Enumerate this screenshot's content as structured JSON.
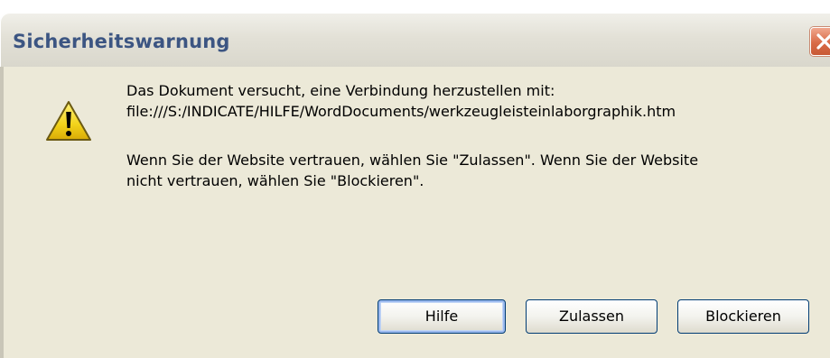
{
  "window": {
    "title": "Sicherheitswarnung",
    "close_icon": "close-icon"
  },
  "dialog": {
    "icon": "warning-icon",
    "message_line1": "Das Dokument versucht, eine Verbindung herzustellen mit:",
    "message_line2": "file:///S:/INDICATE/HILFE/WordDocuments/werkzeugleisteinlaborgraphik.htm",
    "message_line3": "Wenn Sie der Website vertrauen, wählen Sie \"Zulassen\". Wenn Sie der Website",
    "message_line4": "nicht vertrauen, wählen Sie \"Blockieren\"."
  },
  "buttons": {
    "help_label": "Hilfe",
    "allow_label": "Zulassen",
    "block_label": "Blockieren"
  },
  "colors": {
    "title_text": "#3c5582",
    "dialog_background": "#ece9d8",
    "close_button": "#d96b47",
    "warning_yellow": "#f2d21a"
  }
}
